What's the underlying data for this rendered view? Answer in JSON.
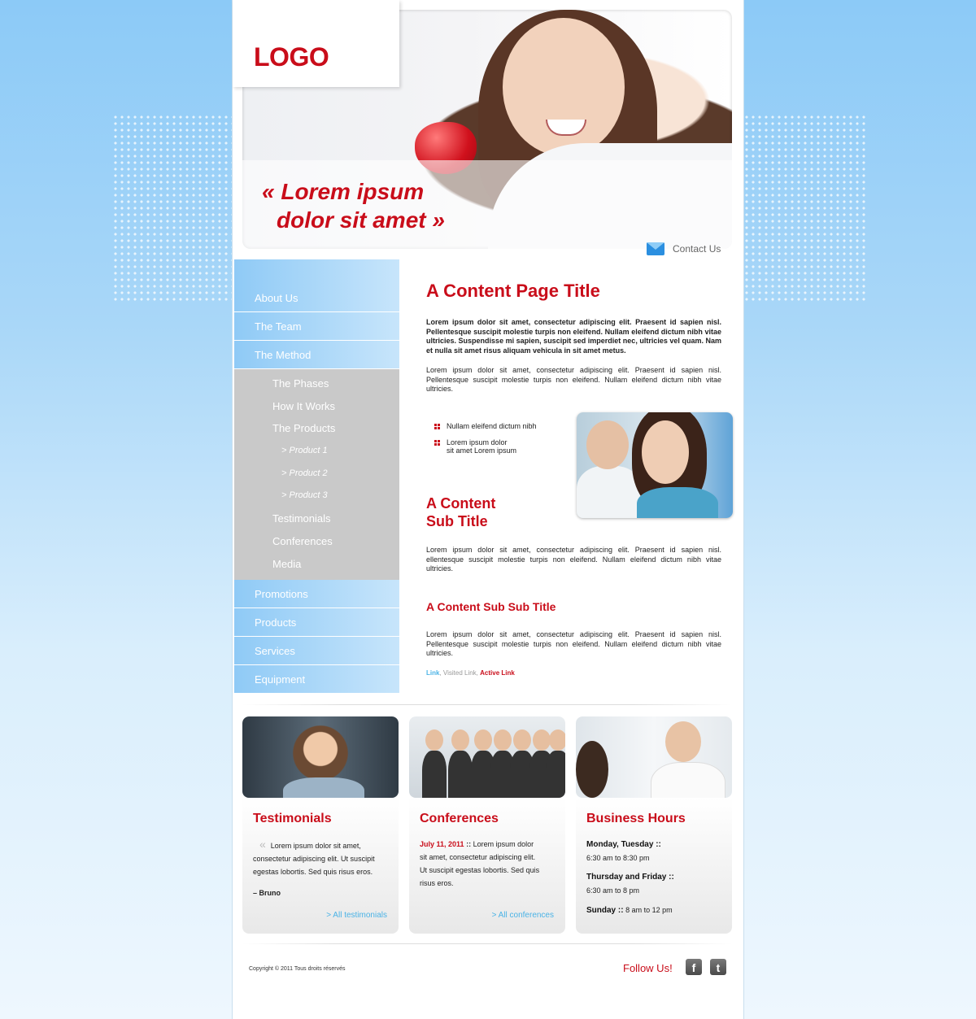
{
  "header": {
    "logo": "LOGO",
    "quote_line1": "« Lorem ipsum",
    "quote_line2": "dolor sit amet »",
    "contact_label": "Contact Us"
  },
  "sidebar": {
    "items_top": [
      "About Us",
      "The Team",
      "The Method"
    ],
    "subitems": [
      "The Phases",
      "How It Works",
      "The Products"
    ],
    "products": [
      "> Product 1",
      "> Product 2",
      "> Product 3"
    ],
    "subitems_after": [
      "Testimonials",
      "Conferences",
      "Media"
    ],
    "items_bottom": [
      "Promotions",
      "Products",
      "Services",
      "Equipment"
    ]
  },
  "content": {
    "title": "A Content Page Title",
    "intro_bold": "Lorem ipsum dolor sit amet, consectetur adipiscing elit. Praesent id sapien nisl. Pellentesque suscipit molestie turpis non eleifend. Nullam eleifend dictum nibh vitae ultricies. Suspendisse mi sapien, suscipit sed imperdiet nec, ultricies vel quam. Nam et nulla sit amet risus aliquam vehicula in sit amet metus.",
    "para1": "Lorem ipsum dolor sit amet, consectetur adipiscing elit. Praesent id sapien nisl. Pellentesque suscipit molestie turpis non eleifend. Nullam eleifend dictum nibh vitae ultricies.",
    "bullet1": "Nullam eleifend dictum nibh",
    "bullet2_line1": "Lorem ipsum dolor",
    "bullet2_line2": "sit amet Lorem ipsum",
    "subtitle_line1": "A Content",
    "subtitle_line2": "Sub Title",
    "para2": "Lorem ipsum dolor sit amet, consectetur adipiscing elit. Praesent id sapien nisl. ellentesque suscipit molestie turpis non eleifend. Nullam eleifend dictum nibh vitae ultricies.",
    "subsubtitle": "A Content Sub Sub Title",
    "para3": "Lorem ipsum dolor sit amet, consectetur adipiscing elit. Praesent id sapien nisl. Pellentesque suscipit molestie turpis non eleifend. Nullam eleifend dictum nibh vitae ultricies.",
    "link": "Link",
    "visited_link": "Visited Link",
    "active_link": "Active Link"
  },
  "cards": {
    "testimonials": {
      "title": "Testimonials",
      "quote_mark": "«",
      "text": "Lorem ipsum dolor sit amet, consectetur adipiscing elit. Ut suscipit egestas lobortis. Sed quis risus eros.",
      "author": "– Bruno",
      "more": ">  All testimonials"
    },
    "conferences": {
      "title": "Conferences",
      "date": "July 11, 2011",
      "sep": "::",
      "text": "Lorem ipsum dolor sit amet, consectetur adipiscing elit. Ut suscipit egestas lobortis. Sed quis risus eros.",
      "more": ">  All conferences"
    },
    "hours": {
      "title": "Business Hours",
      "day1": "Monday, Tuesday  ::",
      "time1": "6:30 am to 8:30 pm",
      "day2": "Thursday and Friday  ::",
      "time2": "6:30 am to 8 pm",
      "day3": "Sunday  ::",
      "time3": "8 am to 12 pm"
    }
  },
  "footer": {
    "copyright": "Copyright © 2011 Tous droits réservés",
    "follow": "Follow Us!",
    "facebook": "f",
    "twitter": "t"
  },
  "colors": {
    "accent": "#c90d1a",
    "link": "#4bb3e6",
    "nav": "#8fcaf6",
    "subnav": "#c9c9c9"
  }
}
